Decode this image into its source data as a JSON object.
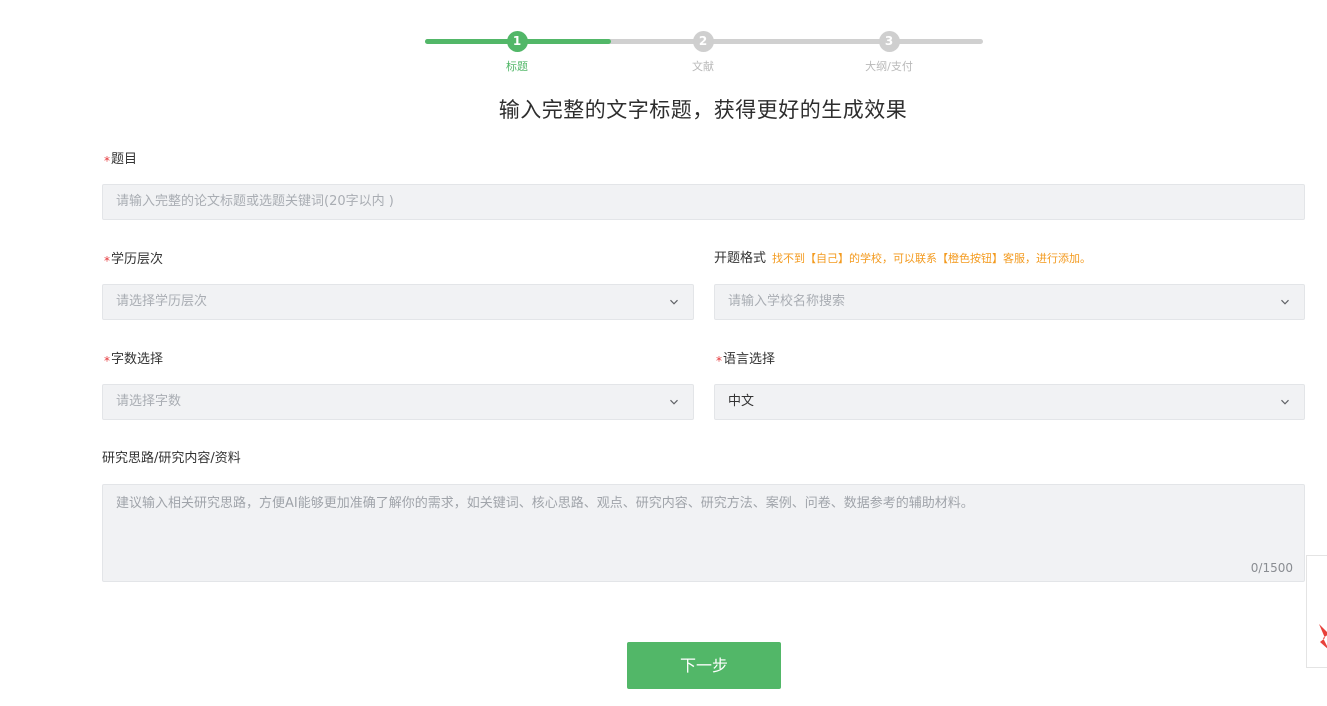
{
  "stepper": {
    "steps": [
      {
        "number": "1",
        "label": "标题",
        "active": true
      },
      {
        "number": "2",
        "label": "文献",
        "active": false
      },
      {
        "number": "3",
        "label": "大纲/支付",
        "active": false
      }
    ]
  },
  "headline": "输入完整的文字标题，获得更好的生成效果",
  "form": {
    "title": {
      "label": "题目",
      "placeholder": "请输入完整的论文标题或选题关键词(20字以内 )"
    },
    "education": {
      "label": "学历层次",
      "placeholder": "请选择学历层次"
    },
    "format": {
      "label": "开题格式",
      "hint": "找不到【自己】的学校，可以联系【橙色按钮】客服，进行添加。",
      "placeholder": "请输入学校名称搜索"
    },
    "word_count": {
      "label": "字数选择",
      "placeholder": "请选择字数"
    },
    "language": {
      "label": "语言选择",
      "value": "中文"
    },
    "research": {
      "label": "研究思路/研究内容/资料",
      "placeholder": "建议输入相关研究思路，方便AI能够更加准确了解你的需求，如关键词、核心思路、观点、研究内容、研究方法、案例、问卷、数据参考的辅助材料。",
      "counter": "0/1500"
    },
    "required_mark": "*"
  },
  "next_button": "下一步",
  "colors": {
    "accent": "#52b768",
    "hint": "#f39a1e",
    "required": "#e5383b"
  }
}
